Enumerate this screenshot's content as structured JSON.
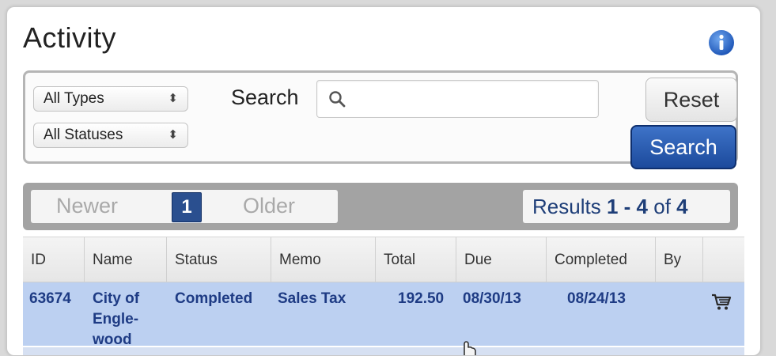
{
  "panel": {
    "title": "Activity"
  },
  "filters": {
    "type_select": "All Types",
    "status_select": "All Statuses",
    "select_arrows": "⬍",
    "search_label": "Search",
    "search_value": "",
    "reset_label": "Reset",
    "search_button_label": "Search"
  },
  "pager": {
    "newer_label": "Newer",
    "current_page": "1",
    "older_label": "Older",
    "results_prefix": "Results",
    "results_start": "1",
    "results_dash": "-",
    "results_end": "4",
    "results_of": "of",
    "results_total": "4"
  },
  "table": {
    "columns": [
      "ID",
      "Name",
      "Status",
      "Memo",
      "Total",
      "Due",
      "Completed",
      "By",
      ""
    ],
    "rows": [
      {
        "id": "63674",
        "name_lines": [
          "City of",
          "Engle-",
          "wood"
        ],
        "status": "Completed",
        "memo": "Sales Tax",
        "total": "192.50",
        "due": "08/30/13",
        "completed": "08/24/13",
        "by": ""
      }
    ]
  },
  "icons": {
    "info": "info-icon",
    "search": "search-icon",
    "cart": "cart-icon",
    "pointer": "hand-pointer-icon"
  },
  "colors": {
    "accent_blue": "#1c4a9c",
    "row_highlight": "#bcd0f1",
    "row_text": "#1e3b84",
    "info_blue": "#2f6fd0"
  }
}
